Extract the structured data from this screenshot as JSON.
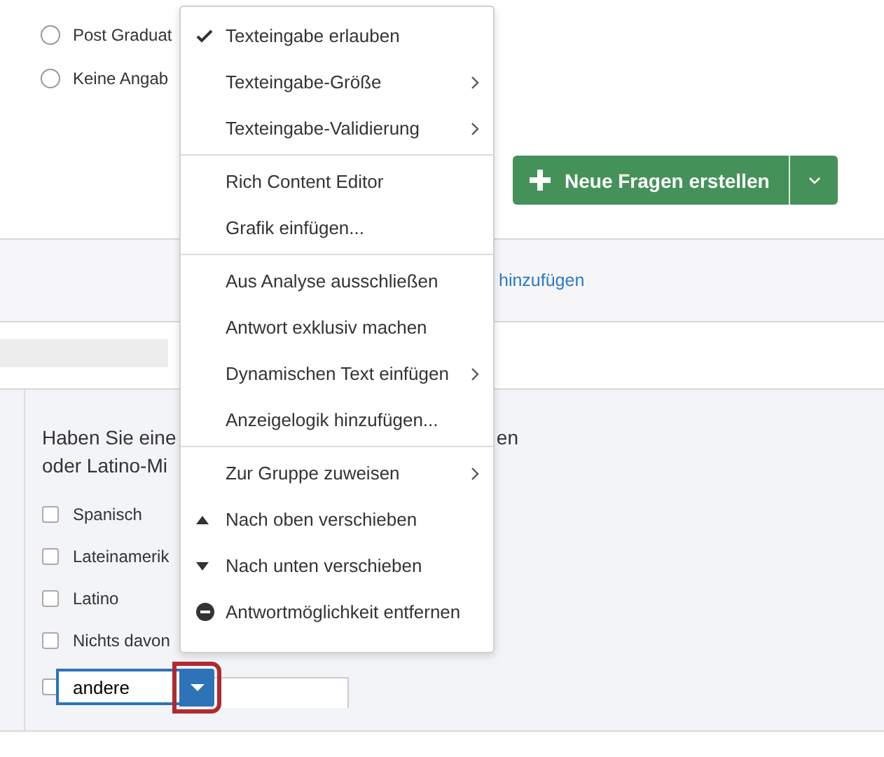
{
  "radio_options": [
    {
      "label": "Post Graduat",
      "selected": false
    },
    {
      "label": "Keine Angab",
      "selected": false
    }
  ],
  "create_button": {
    "label": "Neue Fragen erstellen"
  },
  "add_link": "hinzufügen",
  "question": {
    "line1_start": "Haben Sie eine",
    "line1_end": "en",
    "line2": "oder Latino-Mi",
    "choices": [
      {
        "label": "Spanisch",
        "checked": false
      },
      {
        "label": "Lateinamerik",
        "checked": false
      },
      {
        "label": "Latino",
        "checked": false
      },
      {
        "label": "Nichts davon",
        "checked": false
      }
    ],
    "other_input": {
      "value": "andere",
      "checked": false
    }
  },
  "context_menu": [
    [
      {
        "label": "Texteingabe erlauben",
        "checked": true,
        "submenu": false
      },
      {
        "label": "Texteingabe-Größe",
        "checked": false,
        "submenu": true
      },
      {
        "label": "Texteingabe-Validierung",
        "checked": false,
        "submenu": true
      }
    ],
    [
      {
        "label": "Rich Content Editor",
        "checked": false,
        "submenu": false
      },
      {
        "label": "Grafik einfügen...",
        "checked": false,
        "submenu": false
      }
    ],
    [
      {
        "label": "Aus Analyse ausschließen",
        "checked": false,
        "submenu": false
      },
      {
        "label": "Antwort exklusiv machen",
        "checked": false,
        "submenu": false
      },
      {
        "label": "Dynamischen Text einfügen",
        "checked": false,
        "submenu": true
      },
      {
        "label": "Anzeigelogik hinzufügen...",
        "checked": false,
        "submenu": false
      }
    ],
    [
      {
        "label": "Zur Gruppe zuweisen",
        "checked": false,
        "submenu": true
      },
      {
        "label": "Nach oben verschieben",
        "checked": false,
        "submenu": false,
        "kind": "up"
      },
      {
        "label": "Nach unten verschieben",
        "checked": false,
        "submenu": false,
        "kind": "down"
      },
      {
        "label": "Antwortmöglichkeit entfernen",
        "checked": false,
        "submenu": false,
        "kind": "remove"
      }
    ]
  ]
}
